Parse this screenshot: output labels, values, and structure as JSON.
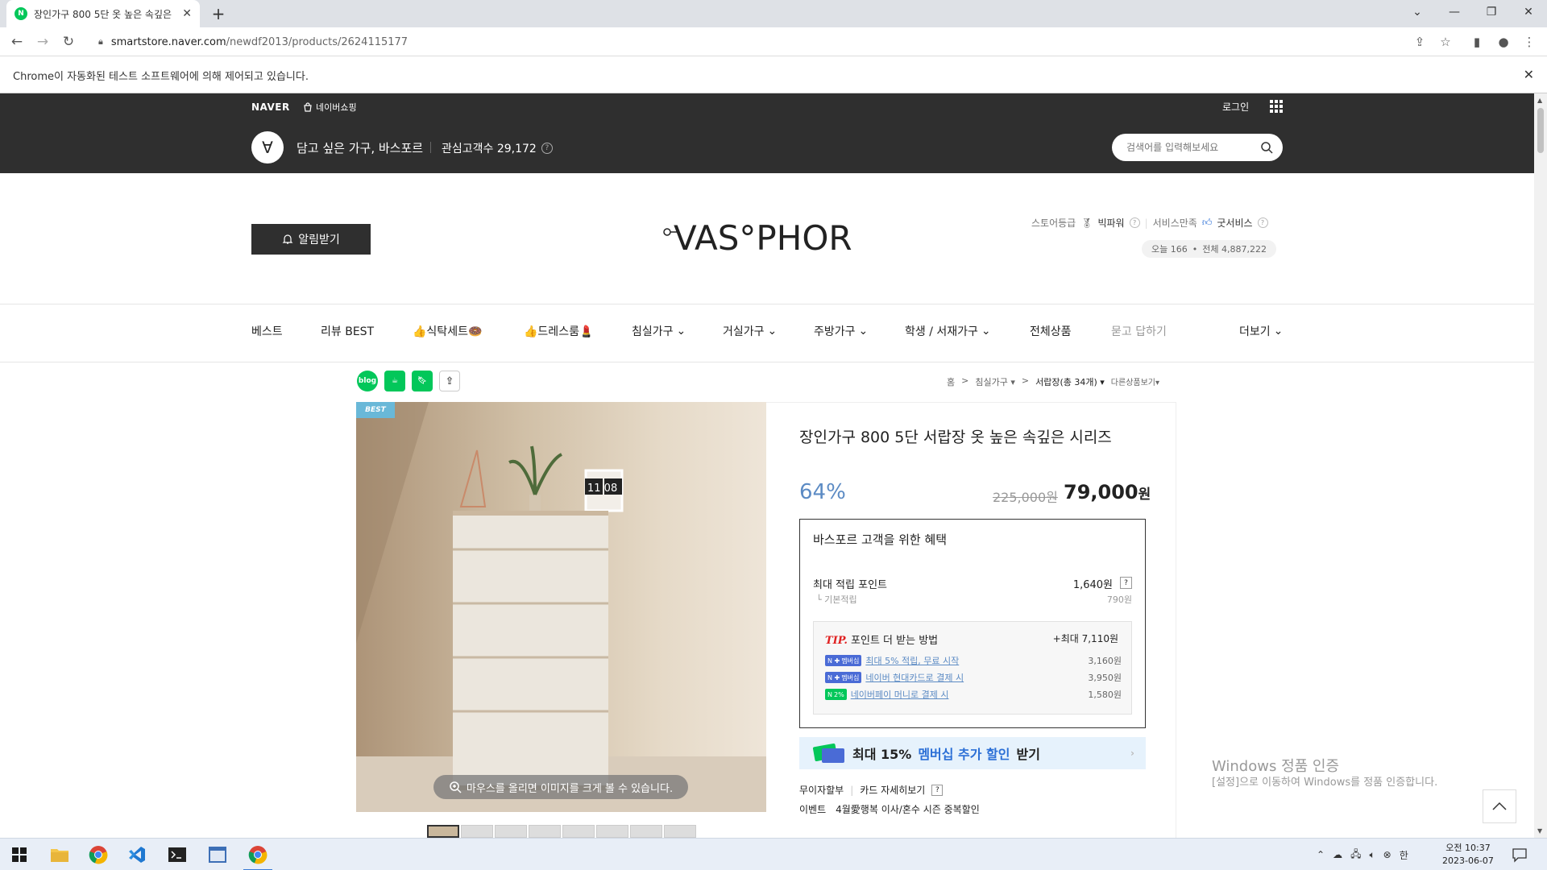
{
  "browser": {
    "tab_title": "장인가구 800 5단 옷 높은 속깊은",
    "new_tab": "+",
    "url_host": "smartstore.naver.com",
    "url_path": "/newdf2013/products/2624115177",
    "automation_notice": "Chrome이 자동화된 테스트 소프트웨어에 의해 제어되고 있습니다."
  },
  "header": {
    "naver_logo": "NAVER",
    "shopping_link": "네이버쇼핑",
    "login": "로그인",
    "store_name": "담고 싶은 가구, 바스포르",
    "interest_label": "관심고객수 29,172",
    "search_placeholder": "검색어를 입력해보세요"
  },
  "brand": {
    "alarm_button": "알림받기",
    "logo_text": "VAS°PHOR",
    "store_grade_label": "스토어등급",
    "store_grade_value": "빅파워",
    "service_label": "서비스만족",
    "service_value": "굿서비스",
    "visits_today": "오늘 166",
    "visits_total": "전체 4,887,222"
  },
  "menu": [
    {
      "label": "베스트",
      "dropdown": false
    },
    {
      "label": "리뷰 BEST",
      "dropdown": false
    },
    {
      "label": "👍식탁세트🍩",
      "dropdown": false
    },
    {
      "label": "👍드레스룸💄",
      "dropdown": false
    },
    {
      "label": "침실가구",
      "dropdown": true
    },
    {
      "label": "거실가구",
      "dropdown": true
    },
    {
      "label": "주방가구",
      "dropdown": true
    },
    {
      "label": "학생 / 서재가구",
      "dropdown": true
    },
    {
      "label": "전체상품",
      "dropdown": false
    },
    {
      "label": "묻고 답하기",
      "dropdown": false
    },
    {
      "label": "더보기",
      "dropdown": true
    }
  ],
  "breadcrumb": {
    "home": "홈",
    "sep": ">",
    "level1": "침실가구",
    "level2": "서랍장(총 34개)",
    "other": "다른상품보기"
  },
  "share": {
    "blog": "blog"
  },
  "product": {
    "best_badge": "BEST",
    "clock_text": "11 08",
    "zoom_hint": "마우스를 올리면 이미지를 크게 볼 수 있습니다.",
    "title": "장인가구 800 5단 서랍장 옷 높은 속깊은 시리즈",
    "discount": "64%",
    "original_price": "225,000원",
    "price": "79,000",
    "price_unit": "원"
  },
  "benefit": {
    "heading": "바스포르 고객을 위한 혜택",
    "max_points_label": "최대 적립 포인트",
    "max_points_value": "1,640원",
    "base_label": "기본적립",
    "base_value": "790원",
    "tip_label": "TIP.",
    "tip_heading": "포인트 더 받는 방법",
    "tip_max": "+최대 7,110원",
    "tips": [
      {
        "badge": "멤버십",
        "text": "최대 5% 적립, 무료 시작",
        "value": "3,160원",
        "color": "#4a6bd6"
      },
      {
        "badge": "멤버십",
        "text": "네이버 현대카드로 결제 시",
        "value": "3,950원",
        "color": "#4a6bd6"
      },
      {
        "badge": "2%",
        "text": "네이버페이 머니로 결제 시",
        "value": "1,580원",
        "color": "#03c75a"
      }
    ]
  },
  "membership_banner": {
    "prefix": "최대 15%",
    "highlight": "멤버십 추가 할인",
    "suffix": "받기"
  },
  "installment": {
    "label": "무이자할부",
    "link": "카드 자세히보기"
  },
  "event": {
    "label": "이벤트",
    "text": "4월愛행복 이사/혼수 시즌 중복할인"
  },
  "windows": {
    "activation_title": "Windows 정품 인증",
    "activation_sub": "[설정]으로 이동하여 Windows를 정품 인증합니다."
  },
  "taskbar": {
    "time": "오전 10:37",
    "date": "2023-06-07",
    "ime": "한"
  },
  "colors": {
    "dark_header": "#2f2f2f",
    "discount_blue": "#5c8bc4",
    "naver_green": "#03c75a"
  }
}
